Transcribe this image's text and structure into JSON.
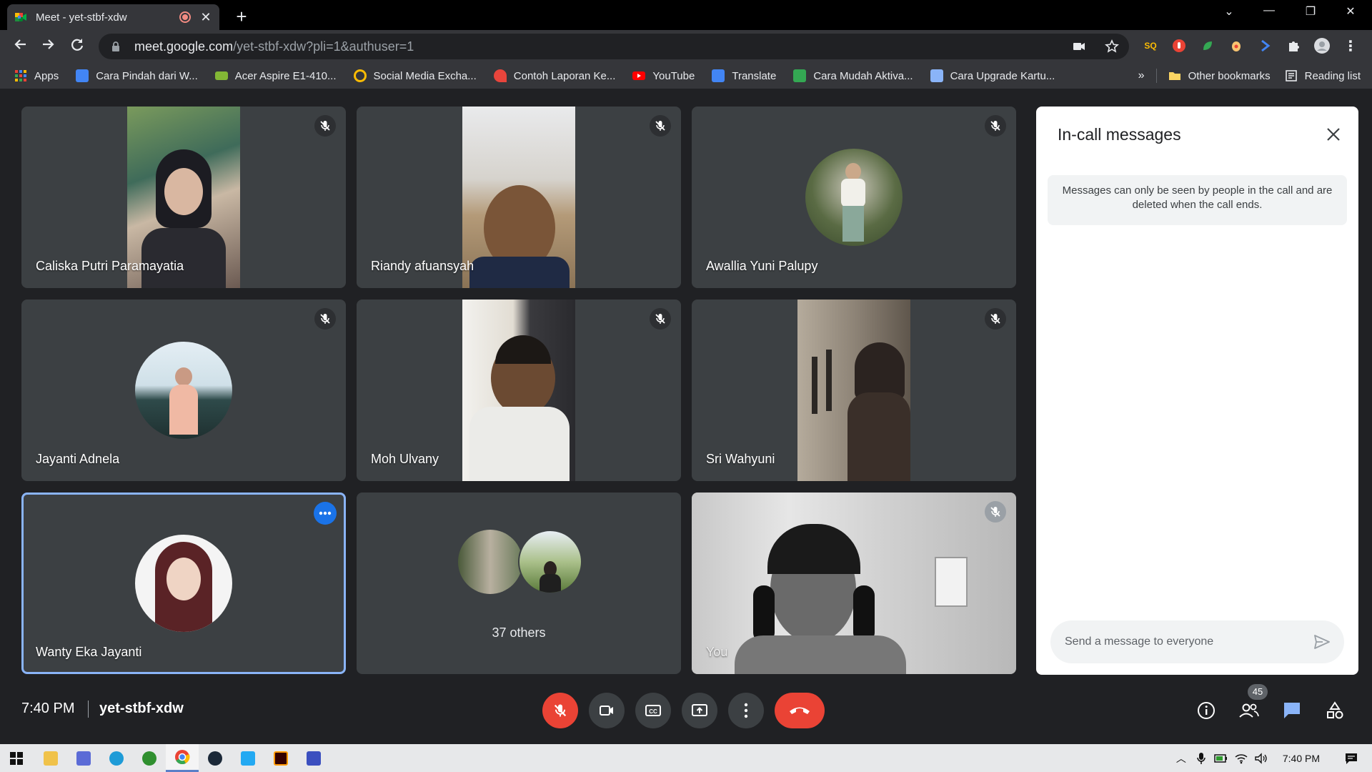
{
  "browser": {
    "tab_title": "Meet - yet-stbf-xdw",
    "url_host": "meet.google.com",
    "url_path": "/yet-stbf-xdw?pli=1&authuser=1"
  },
  "bookmarks": [
    {
      "label": "Apps",
      "icon": "apps-grid-icon",
      "color": "#ea4335"
    },
    {
      "label": "Cara Pindah dari W...",
      "icon": "s-logo-icon",
      "color": "#4285f4"
    },
    {
      "label": "Acer Aspire E1-410...",
      "icon": "acer-icon",
      "color": "#83b735"
    },
    {
      "label": "Social Media Excha...",
      "icon": "ring-icon",
      "color": "#fbbc04"
    },
    {
      "label": "Contoh Laporan Ke...",
      "icon": "rocket-icon",
      "color": "#e8453c"
    },
    {
      "label": "YouTube",
      "icon": "youtube-icon",
      "color": "#ff0000"
    },
    {
      "label": "Translate",
      "icon": "translate-icon",
      "color": "#4285f4"
    },
    {
      "label": "Cara Mudah Aktiva...",
      "icon": "sl-logo-icon",
      "color": "#34a853"
    },
    {
      "label": "Cara Upgrade Kartu...",
      "icon": "store-icon",
      "color": "#4285f4"
    }
  ],
  "bookmarks_right": {
    "overflow": "»",
    "other": "Other bookmarks",
    "reading": "Reading list"
  },
  "tiles": [
    {
      "name": "Caliska Putri Paramayatia",
      "kind": "video"
    },
    {
      "name": "Riandy afuansyah",
      "kind": "video"
    },
    {
      "name": "Awallia Yuni Palupy",
      "kind": "avatar"
    },
    {
      "name": "Jayanti Adnela",
      "kind": "avatar"
    },
    {
      "name": "Moh Ulvany",
      "kind": "video"
    },
    {
      "name": "Sri Wahyuni",
      "kind": "video"
    },
    {
      "name": "Wanty Eka Jayanti",
      "kind": "avatar",
      "active": true
    },
    {
      "name": "37 others",
      "kind": "others"
    },
    {
      "name": "You",
      "kind": "self"
    }
  ],
  "panel": {
    "title": "In-call messages",
    "note": "Messages can only be seen by people in the call and are deleted when the call ends.",
    "input_placeholder": "Send a message to everyone"
  },
  "footer": {
    "time": "7:40 PM",
    "meeting_code": "yet-stbf-xdw",
    "people_count": "45"
  },
  "taskbar": {
    "time": "7:40 PM"
  },
  "colors": {
    "meet_bg": "#202124",
    "tile_bg": "#3c4043",
    "accent_blue": "#1a73e8",
    "danger_red": "#ea4335",
    "active_border": "#8ab4f8"
  }
}
